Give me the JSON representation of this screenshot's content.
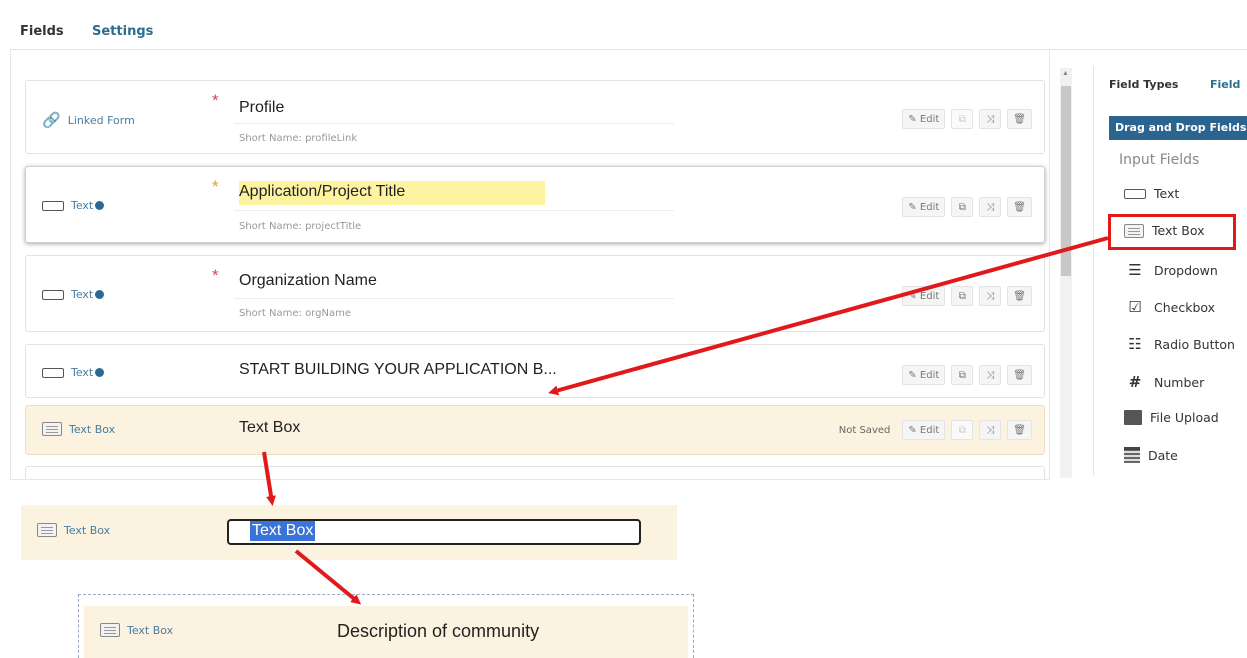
{
  "tabs": {
    "fields": "Fields",
    "settings": "Settings"
  },
  "rows": [
    {
      "type": "Linked Form",
      "label": "Profile",
      "short_name": "Short Name: profileLink",
      "required": true,
      "edit": "Edit"
    },
    {
      "type": "Text",
      "label": "Application/Project Title",
      "short_name": "Short Name: projectTitle",
      "required": true,
      "edit": "Edit"
    },
    {
      "type": "Text",
      "label": "Organization Name",
      "short_name": "Short Name: orgName",
      "required": true,
      "edit": "Edit"
    },
    {
      "type": "Text",
      "label": "START BUILDING YOUR APPLICATION B...",
      "edit": "Edit"
    },
    {
      "type": "Text Box",
      "label": "Text Box",
      "status": "Not Saved",
      "edit": "Edit"
    }
  ],
  "sidebar": {
    "tab_types": "Field Types",
    "tab_field": "Field",
    "header": "Drag and Drop Fields",
    "section": "Input Fields",
    "items": [
      {
        "label": "Text",
        "icon": "text-field-icon"
      },
      {
        "label": "Text Box",
        "icon": "text-box-icon"
      },
      {
        "label": "Dropdown",
        "icon": "dropdown-icon"
      },
      {
        "label": "Checkbox",
        "icon": "checkbox-icon"
      },
      {
        "label": "Radio Button",
        "icon": "radio-list-icon"
      },
      {
        "label": "Number",
        "icon": "hash-icon"
      },
      {
        "label": "File Upload",
        "icon": "upload-icon"
      },
      {
        "label": "Date",
        "icon": "calendar-icon"
      }
    ]
  },
  "step2": {
    "type": "Text Box",
    "value": "Text Box"
  },
  "step3": {
    "type": "Text Box",
    "label": "Description of community"
  },
  "colors": {
    "accent": "#2c6490",
    "highlight_arrow": "#e01a1a",
    "unsaved_bg": "#fbf2df"
  }
}
